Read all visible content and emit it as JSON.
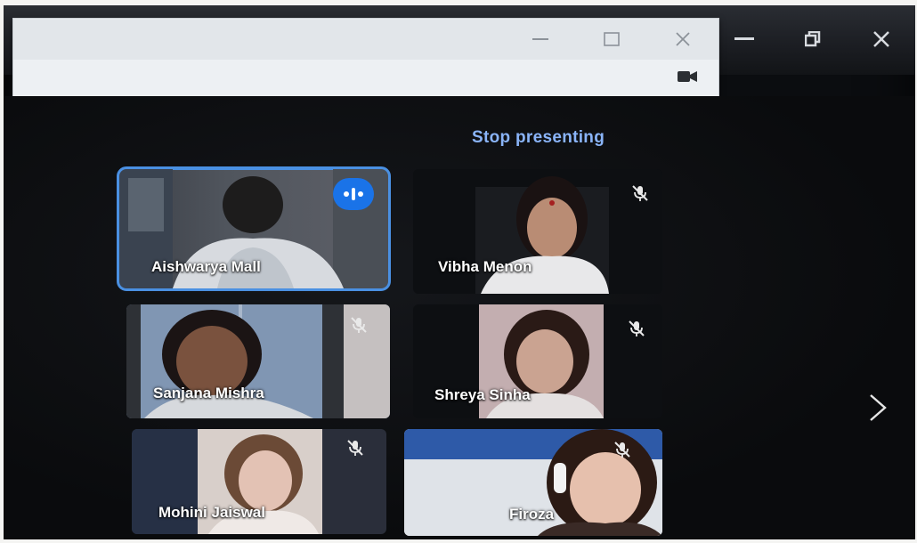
{
  "meeting": {
    "stop_presenting_label": "Stop presenting",
    "participants": [
      {
        "name": "Aishwarya Mall",
        "speaking": true,
        "muted": false
      },
      {
        "name": "Vibha Menon",
        "speaking": false,
        "muted": true
      },
      {
        "name": "Sanjana Mishra",
        "speaking": false,
        "muted": true
      },
      {
        "name": "Shreya Sinha",
        "speaking": false,
        "muted": true
      },
      {
        "name": "Mohini Jaiswal",
        "speaking": false,
        "muted": true
      },
      {
        "name": "Firoza",
        "speaking": false,
        "muted": true
      }
    ]
  },
  "colors": {
    "accent": "#8ab4f8",
    "active_outline": "#4a90e2",
    "speaking_badge": "#1a73e8",
    "background": "#0b0d10"
  },
  "icons": {
    "outer_window": [
      "minimize-icon",
      "restore-icon",
      "close-icon"
    ],
    "mini_window": [
      "minimize-icon",
      "maximize-icon",
      "close-icon"
    ],
    "camera": "camera-icon",
    "mic_off": "mic-off-icon",
    "speaking": "speaking-indicator-icon",
    "next": "chevron-right-icon"
  }
}
